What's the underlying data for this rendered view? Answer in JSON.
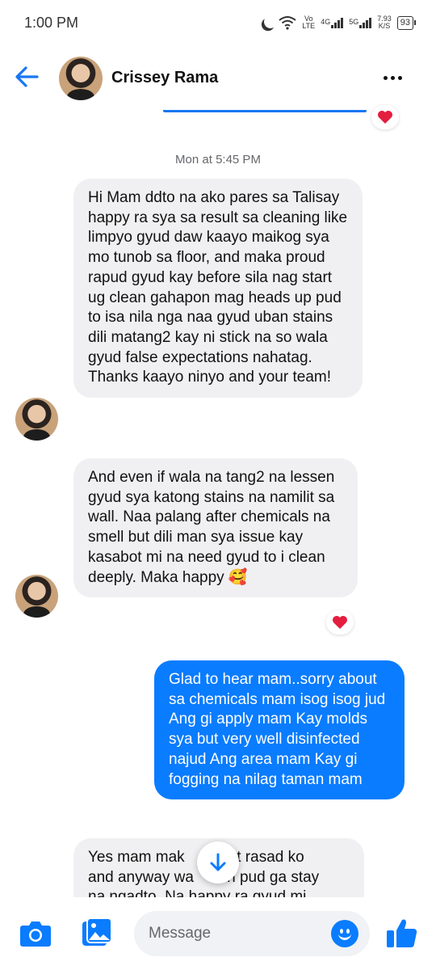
{
  "status_bar": {
    "time": "1:00 PM",
    "volte_top": "Vo",
    "volte_bottom": "LTE",
    "net1": "4G",
    "net2": "5G",
    "speed_top": "7.93",
    "speed_bottom": "K/S",
    "battery": "93"
  },
  "header": {
    "contact_name": "Crissey Rama",
    "back_icon": "arrow-left-icon",
    "more_icon": "more-dots-icon"
  },
  "thread": {
    "timestamp": "Mon at 5:45 PM",
    "reaction_emoji": "heart",
    "messages": [
      {
        "direction": "incoming",
        "text": "Hi Mam ddto na ako pares sa Talisay happy ra sya sa result sa cleaning like limpyo gyud daw kaayo maikog sya mo tunob sa floor, and maka proud rapud gyud kay before sila nag start ug clean gahapon mag heads up pud to isa nila nga naa gyud uban stains dili matang2 kay ni stick na so wala gyud false expectations nahatag. Thanks kaayo ninyo and your team!"
      },
      {
        "direction": "incoming",
        "text": "And even if wala na tang2 na lessen gyud sya katong stains na namilit sa wall. Naa palang after chemicals na smell but dili man sya issue kay kasabot mi na need gyud to i clean deeply. Maka happy 🥰"
      },
      {
        "direction": "outgoing",
        "text": "Glad to hear mam..sorry about sa chemicals mam isog isog jud Ang gi apply mam Kay molds sya but very well disinfected najud Ang area mam Kay gi fogging na nilag taman mam"
      },
      {
        "direction": "incoming",
        "text_line1": "Yes mam mak",
        "text_line1b": "ot rasad ko",
        "text_line2": "and anyway wa",
        "text_line2b": "nan pud ga stay",
        "text_line3": "na ngadto. Na happy ra gyud mi"
      }
    ]
  },
  "composer": {
    "placeholder": "Message"
  },
  "colors": {
    "accent": "#0a7cff",
    "incoming_bubble": "#f0f0f2",
    "heart": "#e41e3f"
  }
}
